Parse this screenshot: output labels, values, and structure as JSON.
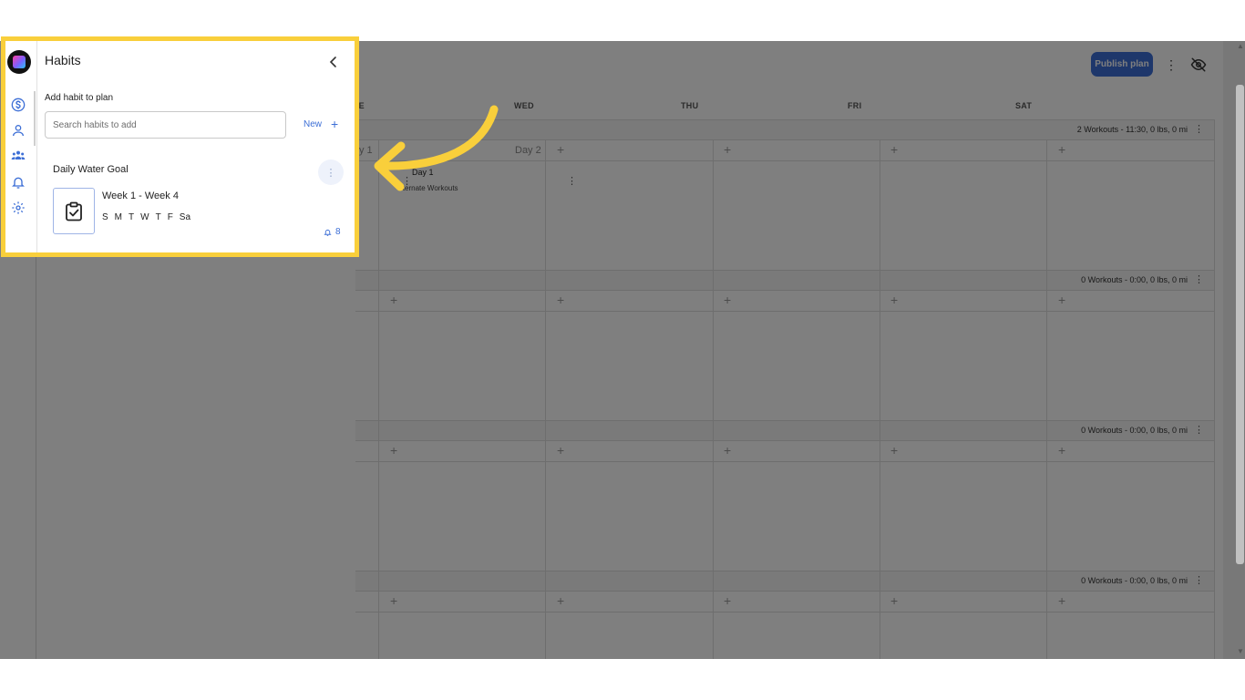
{
  "header": {
    "publish_label": "Publish plan",
    "kebab_glyph": "⋮"
  },
  "calendar": {
    "days": [
      "TUE",
      "WED",
      "THU",
      "FRI",
      "SAT"
    ],
    "weeks": [
      {
        "summary": "2 Workouts - 11:30, 0 lbs, 0 mi"
      },
      {
        "summary": "0 Workouts - 0:00, 0 lbs, 0 mi"
      },
      {
        "summary": "0 Workouts - 0:00, 0 lbs, 0 mi"
      },
      {
        "summary": "0 Workouts - 0:00, 0 lbs, 0 mi"
      }
    ],
    "day1_label": "y 1",
    "day2_label": "Day 2",
    "workout_title": "Day 1",
    "workout_subtitle": "lternate Workouts",
    "plus_glyph": "+"
  },
  "panel": {
    "title": "Habits",
    "add_label": "Add habit to plan",
    "search_placeholder": "Search habits to add",
    "new_label": "New",
    "new_plus": "+",
    "habit": {
      "name": "Daily Water Goal",
      "weeks": "Week 1 - Week 4",
      "days": [
        "S",
        "M",
        "T",
        "W",
        "T",
        "F",
        "Sa"
      ],
      "reminders": "8",
      "kebab_glyph": "⋮"
    }
  },
  "rail_icons": [
    "dollar-icon",
    "person-icon",
    "group-icon",
    "bell-icon",
    "gear-icon"
  ],
  "colors": {
    "highlight": "#f9cf3b",
    "accent": "#3d6fd6",
    "arrow": "#f9cf3b"
  }
}
